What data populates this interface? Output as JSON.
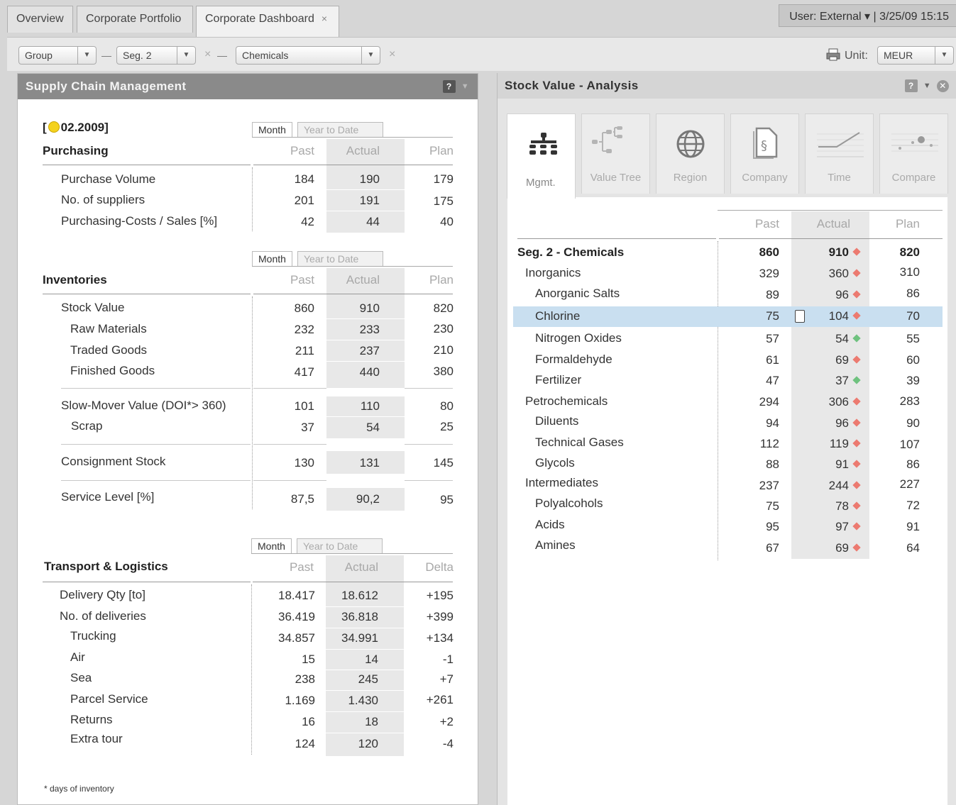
{
  "tabs": [
    {
      "label": "Overview"
    },
    {
      "label": "Corporate Portfolio"
    },
    {
      "label": "Corporate Dashboard",
      "close": "×"
    }
  ],
  "user_info": "User: External  ▾  |  3/25/09  15:15",
  "filters": {
    "group": "Group",
    "segment": "Seg. 2",
    "division": "Chemicals",
    "clear_symbol": "×",
    "unit_label": "Unit:",
    "unit_value": "MEUR"
  },
  "left_panel": {
    "title": "Supply Chain Management",
    "help": "?",
    "period_prefix": "[",
    "period": "02.2009]",
    "purchasing": {
      "title": "Purchasing",
      "tab_month": "Month",
      "tab_ytd": "Year to Date",
      "cols": [
        "Past",
        "Actual",
        "Plan"
      ],
      "rows": [
        {
          "label": "Purchase Volume",
          "past": "184",
          "actual": "190",
          "plan": "179"
        },
        {
          "label": "No. of suppliers",
          "past": "201",
          "actual": "191",
          "plan": "175"
        },
        {
          "label": "Purchasing-Costs / Sales [%]",
          "past": "42",
          "actual": "44",
          "plan": "40"
        }
      ]
    },
    "inventories": {
      "title": "Inventories",
      "tab_month": "Month",
      "tab_ytd": "Year to Date",
      "cols": [
        "Past",
        "Actual",
        "Plan"
      ],
      "rows": [
        {
          "label": "Stock Value",
          "past": "860",
          "actual": "910",
          "plan": "820"
        },
        {
          "label": "Raw Materials",
          "past": "232",
          "actual": "233",
          "plan": "230"
        },
        {
          "label": "Traded Goods",
          "past": "211",
          "actual": "237",
          "plan": "210"
        },
        {
          "label": "Finished Goods",
          "past": "417",
          "actual": "440",
          "plan": "380"
        },
        {
          "label": "Slow-Mover Value (DOI*> 360)",
          "past": "101",
          "actual": "110",
          "plan": "80"
        },
        {
          "label": "Scrap",
          "past": "37",
          "actual": "54",
          "plan": "25"
        },
        {
          "label": "Consignment Stock",
          "past": "130",
          "actual": "131",
          "plan": "145"
        },
        {
          "label": "Service Level [%]",
          "past": "87,5",
          "actual": "90,2",
          "plan": "95"
        }
      ]
    },
    "transport": {
      "title": "Transport & Logistics",
      "tab_month": "Month",
      "tab_ytd": "Year to Date",
      "cols": [
        "Past",
        "Actual",
        "Delta"
      ],
      "rows": [
        {
          "label": "Delivery Qty [to]",
          "past": "18.417",
          "actual": "18.612",
          "delta": "+195"
        },
        {
          "label": "No. of deliveries",
          "past": "36.419",
          "actual": "36.818",
          "delta": "+399"
        },
        {
          "label": "Trucking",
          "past": "34.857",
          "actual": "34.991",
          "delta": "+134"
        },
        {
          "label": "Air",
          "past": "15",
          "actual": "14",
          "delta": "-1"
        },
        {
          "label": "Sea",
          "past": "238",
          "actual": "245",
          "delta": "+7"
        },
        {
          "label": "Parcel Service",
          "past": "1.169",
          "actual": "1.430",
          "delta": "+261"
        },
        {
          "label": "Returns",
          "past": "16",
          "actual": "18",
          "delta": "+2"
        },
        {
          "label": "Extra tour",
          "past": "124",
          "actual": "120",
          "delta": "-4"
        }
      ]
    },
    "footnote": "* days of inventory"
  },
  "right_panel": {
    "title": "Stock Value - Analysis",
    "help": "?",
    "view_tabs": [
      {
        "label": "Mgmt.",
        "icon": "org-chart-icon"
      },
      {
        "label": "Value Tree",
        "icon": "value-tree-icon"
      },
      {
        "label": "Region",
        "icon": "globe-icon"
      },
      {
        "label": "Company",
        "icon": "company-document-icon"
      },
      {
        "label": "Time",
        "icon": "time-line-icon"
      },
      {
        "label": "Compare",
        "icon": "compare-icon"
      }
    ],
    "cols": [
      "Past",
      "Actual",
      "Plan"
    ],
    "rows": [
      {
        "label": "Seg. 2 - Chemicals",
        "past": "860",
        "actual": "910",
        "plan": "820",
        "status": "red",
        "level": 0,
        "bold": true
      },
      {
        "label": "Inorganics",
        "past": "329",
        "actual": "360",
        "plan": "310",
        "status": "red",
        "level": 1
      },
      {
        "label": "Anorganic Salts",
        "past": "89",
        "actual": "96",
        "plan": "86",
        "status": "red",
        "level": 2
      },
      {
        "label": "Chlorine",
        "past": "75",
        "actual": "104",
        "plan": "70",
        "status": "red",
        "level": 2,
        "selected": true
      },
      {
        "label": "Nitrogen Oxides",
        "past": "57",
        "actual": "54",
        "plan": "55",
        "status": "green",
        "level": 2
      },
      {
        "label": "Formaldehyde",
        "past": "61",
        "actual": "69",
        "plan": "60",
        "status": "red",
        "level": 2
      },
      {
        "label": "Fertilizer",
        "past": "47",
        "actual": "37",
        "plan": "39",
        "status": "green",
        "level": 2
      },
      {
        "label": "Petrochemicals",
        "past": "294",
        "actual": "306",
        "plan": "283",
        "status": "red",
        "level": 1
      },
      {
        "label": "Diluents",
        "past": "94",
        "actual": "96",
        "plan": "90",
        "status": "red",
        "level": 2
      },
      {
        "label": "Technical Gases",
        "past": "112",
        "actual": "119",
        "plan": "107",
        "status": "red",
        "level": 2
      },
      {
        "label": "Glycols",
        "past": "88",
        "actual": "91",
        "plan": "86",
        "status": "red",
        "level": 2
      },
      {
        "label": "Intermediates",
        "past": "237",
        "actual": "244",
        "plan": "227",
        "status": "red",
        "level": 1
      },
      {
        "label": "Polyalcohols",
        "past": "75",
        "actual": "78",
        "plan": "72",
        "status": "red",
        "level": 2
      },
      {
        "label": "Acids",
        "past": "95",
        "actual": "97",
        "plan": "91",
        "status": "red",
        "level": 2
      },
      {
        "label": "Amines",
        "past": "67",
        "actual": "69",
        "plan": "64",
        "status": "red",
        "level": 2
      }
    ]
  },
  "colors": {
    "status_red": "#ec7a70",
    "status_green": "#6fc27f",
    "selection": "#c9dff0",
    "header_dark": "#8a8a8a"
  }
}
